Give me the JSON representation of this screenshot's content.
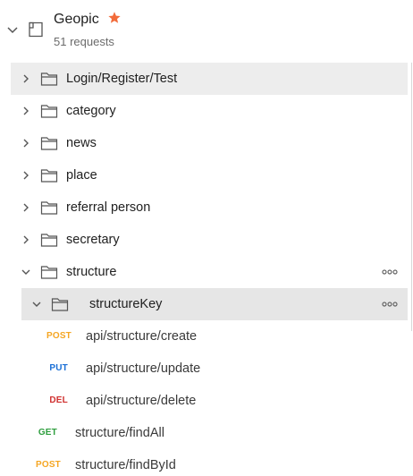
{
  "collection": {
    "name": "Geopic",
    "subtitle": "51 requests",
    "icons": {
      "toggle": "chevron-down-icon",
      "type": "collection-icon",
      "favorite": "star-icon"
    },
    "star_color": "#f26b3a"
  },
  "folders": [
    {
      "label": "Login/Register/Test",
      "expanded": false
    },
    {
      "label": "category",
      "expanded": false
    },
    {
      "label": "news",
      "expanded": false
    },
    {
      "label": "place",
      "expanded": false
    },
    {
      "label": "referral person",
      "expanded": false
    },
    {
      "label": "secretary",
      "expanded": false
    },
    {
      "label": "structure",
      "expanded": true
    }
  ],
  "subfolder": {
    "label": "structureKey",
    "expanded": true
  },
  "nested_requests": [
    {
      "method": "POST",
      "path": "api/structure/create"
    },
    {
      "method": "PUT",
      "path": "api/structure/update"
    },
    {
      "method": "DEL",
      "path": "api/structure/delete"
    }
  ],
  "requests": [
    {
      "method": "GET",
      "path": "structure/findAll"
    },
    {
      "method": "POST",
      "path": "structure/findById"
    }
  ],
  "method_colors": {
    "POST": "#f5a623",
    "PUT": "#1a6fd6",
    "DEL": "#d0302f",
    "GET": "#2e9e3e"
  }
}
